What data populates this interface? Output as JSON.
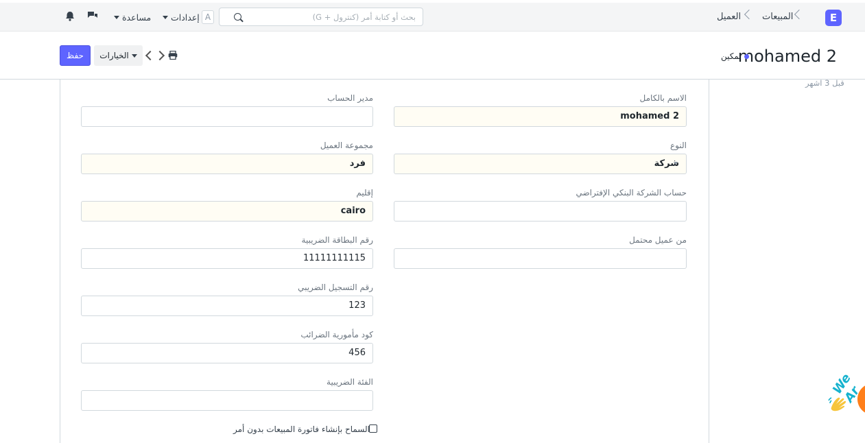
{
  "navbar": {
    "logo_letter": "E",
    "breadcrumbs": [
      "المبيعات",
      "العميل"
    ],
    "search_placeholder": "بحث أو كتابة أمر (كنترول + G)",
    "avatar_letter": "A",
    "settings_label": "إعدادات",
    "help_label": "مساعدة"
  },
  "page_head": {
    "title": "mohamed 2",
    "status": "تمكين",
    "options_label": "الخيارات",
    "save_label": "حفظ"
  },
  "sidebar": {
    "modified": "قبل 3 اشهر"
  },
  "form": {
    "full_name": {
      "label": "الاسم بالكامل",
      "value": "mohamed 2"
    },
    "account_manager": {
      "label": "مدير الحساب",
      "value": ""
    },
    "type": {
      "label": "النوع",
      "value": "شركة"
    },
    "customer_group": {
      "label": "مجموعة العميل",
      "value": "فرد"
    },
    "default_bank_account": {
      "label": "حساب الشركة البنكي الإفتراضي",
      "value": ""
    },
    "territory": {
      "label": "إقليم",
      "value": "cairo"
    },
    "from_lead": {
      "label": "من عميل محتمل",
      "value": ""
    },
    "tax_card_number": {
      "label": "رقم البطاقة الضريبية",
      "value": "11111111115"
    },
    "tax_registration_number": {
      "label": "رقم التسجيل الضريبي",
      "value": "123"
    },
    "tax_office_code": {
      "label": "كود مأمورية الضرائب",
      "value": "456"
    },
    "tax_category": {
      "label": "الفئة الضريبية",
      "value": ""
    },
    "allow_sales_invoice_label": "السماح بإنشاء فاتورة المبيعات بدون أمر"
  },
  "widget": {
    "text": "We Ar"
  },
  "colors": {
    "accent": "#5e64ff",
    "required_bg": "#fffdf4",
    "widget_orange": "#ff7f1a"
  }
}
